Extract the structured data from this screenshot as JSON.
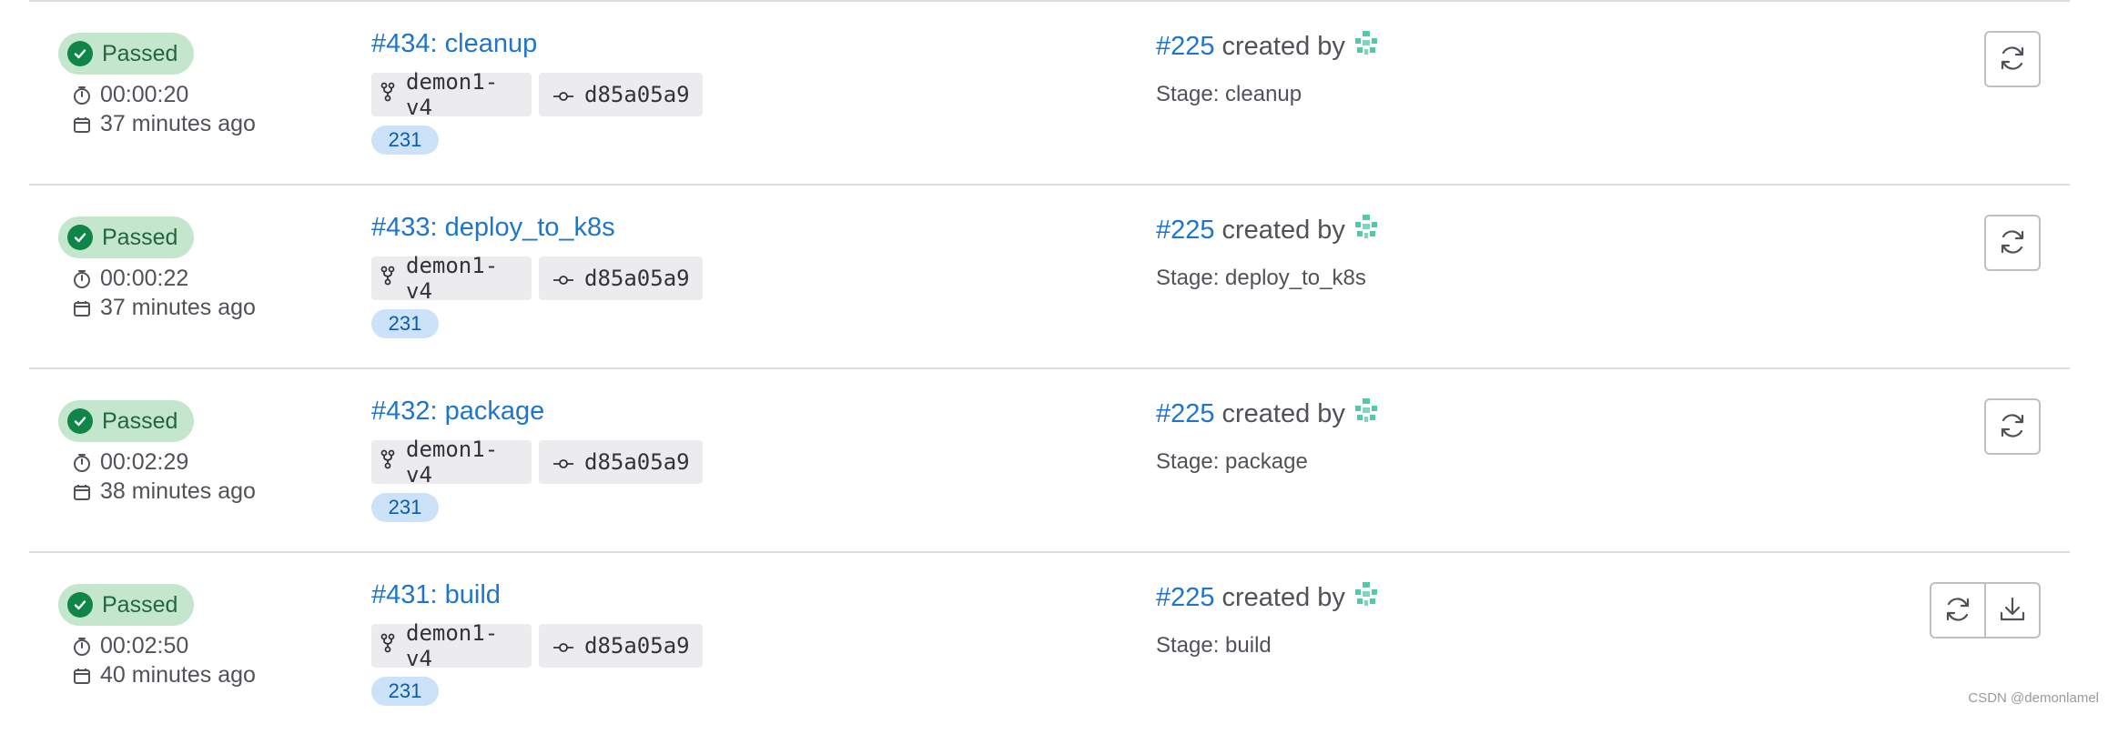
{
  "jobs": [
    {
      "status": "Passed",
      "duration": "00:00:20",
      "created_ago": "37 minutes ago",
      "title": "#434: cleanup",
      "branch": "demon1-v4",
      "commit": "d85a05a9",
      "label": "231",
      "pipeline": "#225",
      "created_by": "created by",
      "stage": "Stage: cleanup",
      "actions": [
        "retry-icon"
      ]
    },
    {
      "status": "Passed",
      "duration": "00:00:22",
      "created_ago": "37 minutes ago",
      "title": "#433: deploy_to_k8s",
      "branch": "demon1-v4",
      "commit": "d85a05a9",
      "label": "231",
      "pipeline": "#225",
      "created_by": "created by",
      "stage": "Stage: deploy_to_k8s",
      "actions": [
        "retry-icon"
      ]
    },
    {
      "status": "Passed",
      "duration": "00:02:29",
      "created_ago": "38 minutes ago",
      "title": "#432: package",
      "branch": "demon1-v4",
      "commit": "d85a05a9",
      "label": "231",
      "pipeline": "#225",
      "created_by": "created by",
      "stage": "Stage: package",
      "actions": [
        "retry-icon"
      ]
    },
    {
      "status": "Passed",
      "duration": "00:02:50",
      "created_ago": "40 minutes ago",
      "title": "#431: build",
      "branch": "demon1-v4",
      "commit": "d85a05a9",
      "label": "231",
      "pipeline": "#225",
      "created_by": "created by",
      "stage": "Stage: build",
      "actions": [
        "retry-icon",
        "download-icon"
      ]
    }
  ],
  "colors": {
    "success": "#108548",
    "link": "#1f75cb",
    "badge_bg": "#c3e6cd"
  },
  "watermark": "CSDN @demonlamel"
}
